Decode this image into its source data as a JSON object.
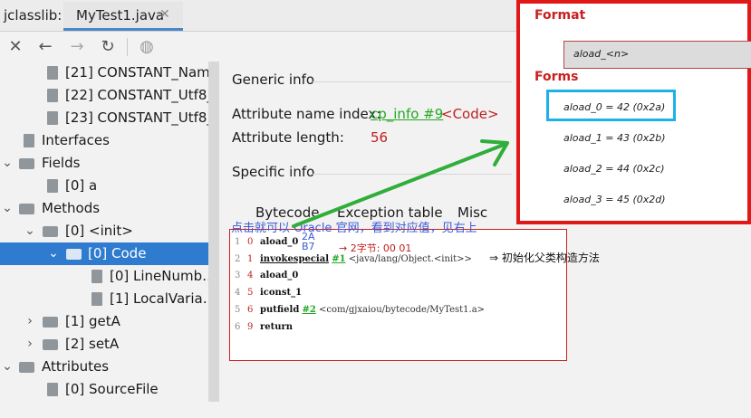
{
  "tabs": {
    "plugin_label": "jclasslib:",
    "file_tab": "MyTest1.java",
    "close_glyph": "✕"
  },
  "toolbar": {
    "close": "✕",
    "back": "←",
    "forward": "→",
    "refresh": "↻",
    "browser": "◍"
  },
  "tree": {
    "items": [
      {
        "label": "[21] CONSTANT_Nam…",
        "icon": "file-icon",
        "chevron": ""
      },
      {
        "label": "[22] CONSTANT_Utf8_…",
        "icon": "file-icon",
        "chevron": ""
      },
      {
        "label": "[23] CONSTANT_Utf8_…",
        "icon": "file-icon",
        "chevron": ""
      },
      {
        "label": "Interfaces",
        "icon": "file-icon",
        "chevron": ""
      },
      {
        "label": "Fields",
        "icon": "folder-icon",
        "chevron": "⌄"
      },
      {
        "label": "[0] a",
        "icon": "file-icon",
        "chevron": ""
      },
      {
        "label": "Methods",
        "icon": "folder-icon",
        "chevron": "⌄"
      },
      {
        "label": "[0] <init>",
        "icon": "folder-icon",
        "chevron": "⌄"
      },
      {
        "label": "[0] Code",
        "icon": "folder-icon",
        "chevron": "⌄"
      },
      {
        "label": "[0] LineNumb…",
        "icon": "file-icon",
        "chevron": ""
      },
      {
        "label": "[1] LocalVaria…",
        "icon": "file-icon",
        "chevron": ""
      },
      {
        "label": "[1] getA",
        "icon": "folder-icon",
        "chevron": "›"
      },
      {
        "label": "[2] setA",
        "icon": "folder-icon",
        "chevron": "›"
      },
      {
        "label": "Attributes",
        "icon": "folder-icon",
        "chevron": "⌄"
      },
      {
        "label": "[0] SourceFile",
        "icon": "file-icon",
        "chevron": ""
      }
    ]
  },
  "main": {
    "generic_info": "Generic info",
    "attr_name_index_label": "Attribute name index:",
    "attr_name_index_link": "cp_info #9",
    "attr_name_index_value": "<Code>",
    "attr_length_label": "Attribute length:",
    "attr_length_value": "56",
    "specific_info": "Specific info",
    "subtabs": [
      "Bytecode",
      "Exception table",
      "Misc"
    ]
  },
  "bytecode": {
    "lines": [
      {
        "line": "1",
        "offset": "0",
        "instr": "aload_0",
        "ref": "",
        "comment": ""
      },
      {
        "line": "2",
        "offset": "1",
        "instr": "invokespecial",
        "ref": "#1",
        "comment": "<java/lang/Object.<init>>"
      },
      {
        "line": "3",
        "offset": "4",
        "instr": "aload_0",
        "ref": "",
        "comment": ""
      },
      {
        "line": "4",
        "offset": "5",
        "instr": "iconst_1",
        "ref": "",
        "comment": ""
      },
      {
        "line": "5",
        "offset": "6",
        "instr": "putfield",
        "ref": "#2",
        "comment": "<com/gjxaiou/bytecode/MyTest1.a>"
      },
      {
        "line": "6",
        "offset": "9",
        "instr": "return",
        "ref": "",
        "comment": ""
      }
    ]
  },
  "annotations": {
    "blue_note": "点击就可以 Oracle 官网，看到对应值，见右上",
    "byte_note": "2A\nB7",
    "red_note": "→ 2字节: 00 01",
    "black_note": "⇒ 初始化父类构造方法"
  },
  "popup": {
    "format_title": "Format",
    "format_text": "aload_<n>",
    "forms_title": "Forms",
    "forms": [
      "aload_0 = 42 (0x2a)",
      "aload_1 = 43 (0x2b)",
      "aload_2 = 44 (0x2c)",
      "aload_3 = 45 (0x2d)"
    ]
  },
  "colors": {
    "selection": "#2e7bcf",
    "popup_border": "#e01818",
    "link": "#22a722",
    "highlight": "#1cb2e8",
    "arrow": "#2fae3a"
  }
}
